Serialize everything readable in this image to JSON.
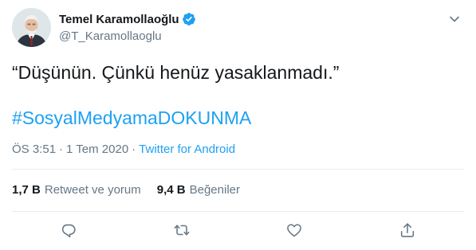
{
  "author": {
    "display_name": "Temel Karamollaoğlu",
    "handle": "@T_Karamollaoglu",
    "verified_icon": "verified-badge-icon"
  },
  "tweet": {
    "text": "“Düşünün. Çünkü henüz yasaklanmadı.”",
    "hashtag": "#SosyalMedyamaDOKUNMA"
  },
  "meta": {
    "time": "ÖS 3:51",
    "separator": "·",
    "date": "1 Tem 2020",
    "source": "Twitter for Android"
  },
  "stats": {
    "retweets_value": "1,7 B",
    "retweets_label": "Retweet ve yorum",
    "likes_value": "9,4 B",
    "likes_label": "Beğeniler"
  },
  "actions": {
    "reply_icon": "reply-icon",
    "retweet_icon": "retweet-icon",
    "like_icon": "heart-icon",
    "share_icon": "share-icon"
  },
  "colors": {
    "accent": "#1da1f2",
    "text": "#14171a",
    "secondary": "#657786",
    "divider": "#e6ecf0"
  }
}
